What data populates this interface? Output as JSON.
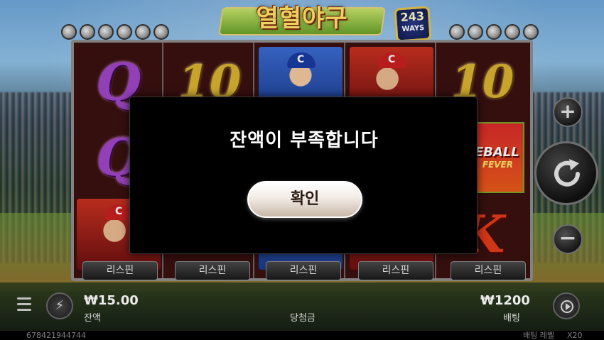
{
  "game": {
    "title": "열혈야구",
    "ways_count": "243",
    "ways_label": "WAYS"
  },
  "reels": {
    "symbols": {
      "q": "Q",
      "ten": "10",
      "k": "K",
      "baseball": "BASEBALL",
      "fever": "FEVER",
      "cap_logo": "C"
    },
    "respin_label": "리스핀"
  },
  "controls": {
    "plus": "+",
    "minus": "−",
    "turbo": "⚡"
  },
  "bottom": {
    "balance_amount": "₩15.00",
    "balance_label": "잔액",
    "win_label": "당첨금",
    "bet_amount": "₩1200",
    "bet_label": "배팅",
    "session_id": "678421944744",
    "bet_level_label": "배팅 레벨",
    "bet_level_value": "X20"
  },
  "modal": {
    "message": "잔액이 부족합니다",
    "confirm_label": "확인"
  }
}
